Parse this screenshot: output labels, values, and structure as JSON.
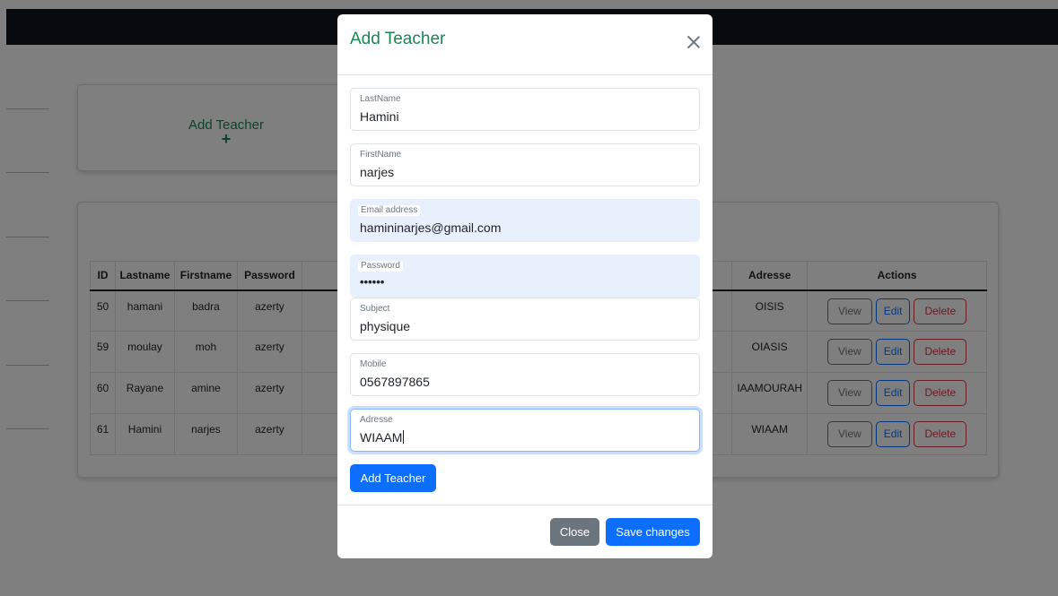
{
  "page": {
    "add_card": {
      "label": "Add Teacher",
      "plus": "+"
    },
    "table": {
      "headers": [
        "ID",
        "Lastname",
        "Firstname",
        "Password",
        "",
        "Adresse",
        "Actions"
      ],
      "rows": [
        {
          "id": "50",
          "lastname": "hamani",
          "firstname": "badra",
          "password": "azerty",
          "adresse": "OISIS"
        },
        {
          "id": "59",
          "lastname": "moulay",
          "firstname": "moh",
          "password": "azerty",
          "adresse": "OIASIS"
        },
        {
          "id": "60",
          "lastname": "Rayane",
          "firstname": "amine",
          "password": "azerty",
          "adresse": "IAAMOURAH"
        },
        {
          "id": "61",
          "lastname": "Hamini",
          "firstname": "narjes",
          "password": "azerty",
          "adresse": "WIAAM"
        }
      ],
      "actions": {
        "view": "View",
        "edit": "Edit",
        "delete": "Delete"
      }
    }
  },
  "modal": {
    "title": "Add Teacher",
    "fields": {
      "lastname": {
        "label": "LastName",
        "value": "Hamini"
      },
      "firstname": {
        "label": "FirstName",
        "value": "narjes"
      },
      "email": {
        "label": "Email address",
        "value": "hamininarjes@gmail.com"
      },
      "password": {
        "label": "Password",
        "value": "••••••"
      },
      "subject": {
        "label": "Subject",
        "value": "physique"
      },
      "mobile": {
        "label": "Mobile",
        "value": "0567897865"
      },
      "adresse": {
        "label": "Adresse",
        "value": "WIAAM"
      }
    },
    "add_button": "Add Teacher",
    "close_button": "Close",
    "save_button": "Save changes"
  },
  "colors": {
    "accent_green": "#198754",
    "primary_blue": "#0d6efd",
    "danger_red": "#dc3545",
    "secondary_gray": "#6c757d",
    "topbar": "#0e1620"
  }
}
